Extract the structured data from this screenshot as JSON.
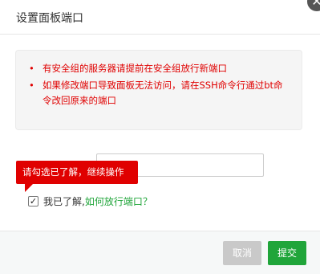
{
  "dialog": {
    "title": "设置面板端口",
    "close_glyph": "✕"
  },
  "notice": {
    "bullet": "•",
    "items": [
      "有安全组的服务器请提前在安全组放行新端口",
      "如果修改端口导致面板无法访问，请在SSH命令行通过bt命令改回原来的端口"
    ]
  },
  "form": {
    "port_value": ""
  },
  "tooltip": {
    "text": "请勾选已了解，继续操作"
  },
  "agree": {
    "checked": true,
    "check_glyph": "✓",
    "text": "我已了解,",
    "link": "如何放行端口？"
  },
  "footer": {
    "cancel_label": "取消",
    "submit_label": "提交"
  },
  "colors": {
    "warning": "#e00000",
    "primary": "#20a53a",
    "disabled": "#c9c9c9"
  }
}
